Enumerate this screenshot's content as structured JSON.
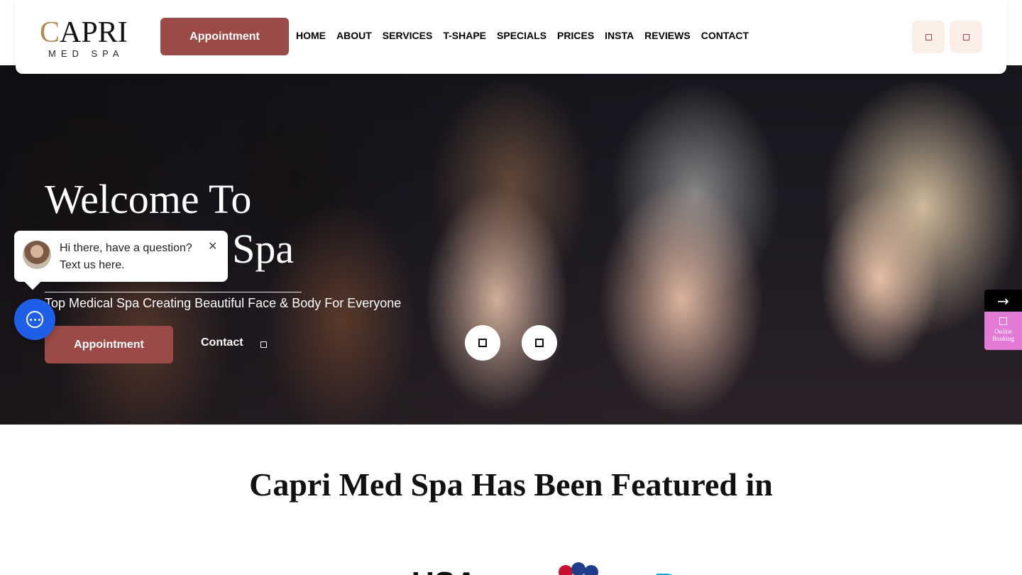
{
  "header": {
    "logo_text": "CAPRI",
    "logo_sub": "MED SPA",
    "appointment_label": "Appointment",
    "nav": [
      "HOME",
      "ABOUT",
      "SERVICES",
      "T-SHAPE",
      "SPECIALS",
      "PRICES",
      "INSTA",
      "REVIEWS",
      "CONTACT"
    ],
    "icons": [
      "phone-icon",
      "location-icon"
    ]
  },
  "hero": {
    "title_line1": "Welcome To",
    "title_line2": "Capri Med Spa",
    "subtitle": "Top Medical Spa Creating Beautiful Face & Body For Everyone",
    "appointment_label": "Appointment",
    "contact_label": "Contact",
    "slider_icons": [
      "prev-slide-icon",
      "next-slide-icon"
    ]
  },
  "chat": {
    "message": "Hi there, have a question? Text us here.",
    "close_symbol": "✕"
  },
  "side_booking": {
    "arrow": "→",
    "label": "Online Booking"
  },
  "featured": {
    "title": "Capri Med Spa Has Been Featured in"
  },
  "colors": {
    "accent": "#9c4a47",
    "gold": "#b08a50",
    "chat_blue": "#1f5ee6",
    "booking_pink": "#e27ad6",
    "icon_bg": "#fbeee6"
  }
}
